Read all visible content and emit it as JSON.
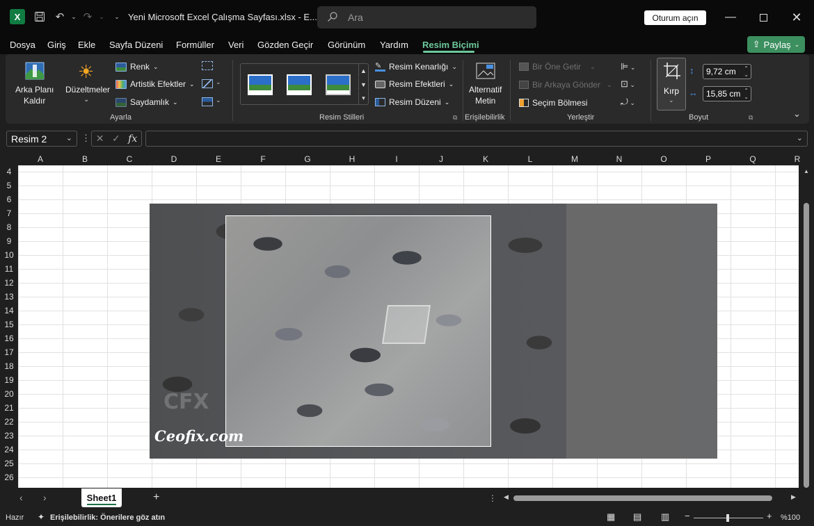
{
  "titlebar": {
    "doc_title": "Yeni Microsoft Excel Çalışma Sayfası.xlsx  -  E...",
    "search_placeholder": "Ara",
    "signin_label": "Oturum açın"
  },
  "menu": {
    "items": [
      "Dosya",
      "Giriş",
      "Ekle",
      "Sayfa Düzeni",
      "Formüller",
      "Veri",
      "Gözden Geçir",
      "Görünüm",
      "Yardım",
      "Resim Biçimi"
    ],
    "active": "Resim Biçimi",
    "share_label": "Paylaş"
  },
  "ribbon": {
    "remove_bg": [
      "Arka Planı",
      "Kaldır"
    ],
    "corrections": "Düzeltmeler",
    "color": "Renk",
    "artistic": "Artistik Efektler",
    "transparency": "Saydamlık",
    "group_adjust": "Ayarla",
    "border": "Resim Kenarlığı",
    "effects": "Resim Efektleri",
    "layout": "Resim Düzeni",
    "group_styles": "Resim Stilleri",
    "alt_text": [
      "Alternatif",
      "Metin"
    ],
    "group_access": "Erişilebilirlik",
    "bring_forward": "Bir Öne Getir",
    "send_backward": "Bir Arkaya Gönder",
    "selection_pane": "Seçim Bölmesi",
    "group_arrange": "Yerleştir",
    "crop": "Kırp",
    "height": "9,72 cm",
    "width": "15,85 cm",
    "group_size": "Boyut"
  },
  "formula": {
    "name_box": "Resim 2",
    "fx": "fx",
    "value": ""
  },
  "grid": {
    "columns": [
      "A",
      "B",
      "C",
      "D",
      "E",
      "F",
      "G",
      "H",
      "I",
      "J",
      "K",
      "L",
      "M",
      "N",
      "O",
      "P",
      "Q",
      "R"
    ],
    "rows": [
      "4",
      "5",
      "6",
      "7",
      "8",
      "9",
      "10",
      "11",
      "12",
      "13",
      "14",
      "15",
      "16",
      "17",
      "18",
      "19",
      "20",
      "21",
      "22",
      "23",
      "24",
      "25",
      "26"
    ]
  },
  "picture": {
    "watermark": "Ceofix.com",
    "watermark_logo": "CFX"
  },
  "sheets": {
    "tabs": [
      "Sheet1"
    ],
    "add_label": "+"
  },
  "status": {
    "ready": "Hazır",
    "accessibility": "Erişilebilirlik: Önerilere göz atın",
    "zoom": "%100"
  },
  "colors": {
    "excel_green": "#107c41",
    "accent": "#6dc89b",
    "share_button": "#3c8f5f"
  }
}
